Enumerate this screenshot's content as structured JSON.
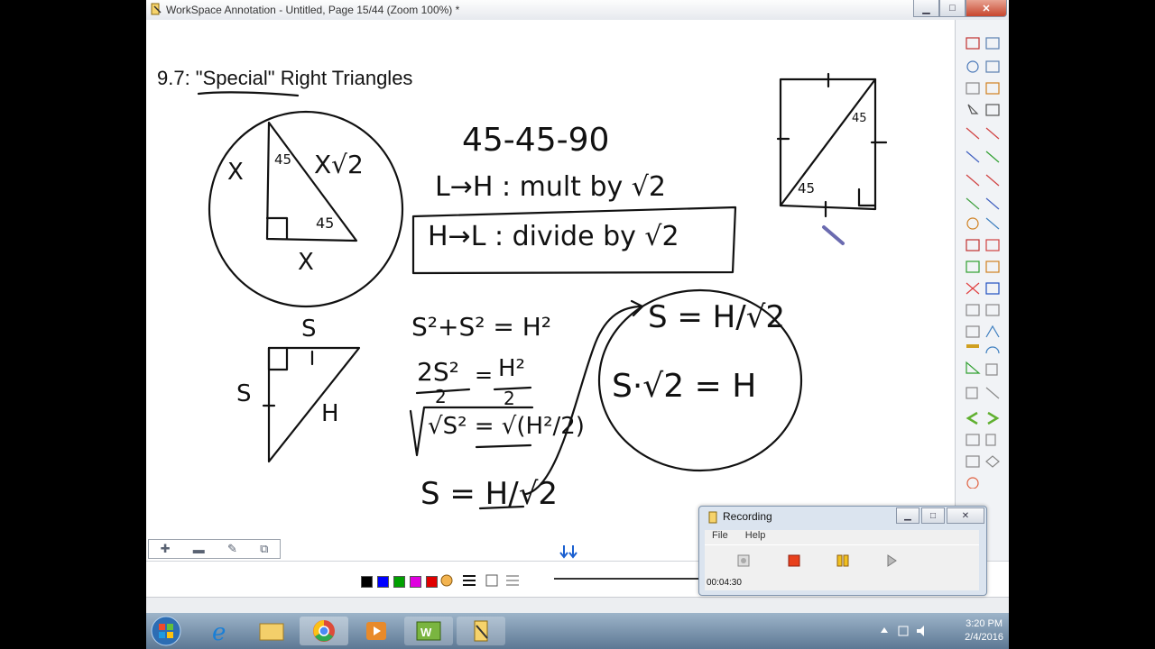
{
  "window": {
    "title": "WorkSpace Annotation - Untitled, Page 15/44  (Zoom 100%) *",
    "minimize": "▁",
    "maximize": "□",
    "close": "✕"
  },
  "heading": "9.7: \"Special\" Right Triangles",
  "handwriting": {
    "label_x_left": "X",
    "label_45_top": "45",
    "label_xroot2": "X√2",
    "label_45_bottom": "45",
    "label_x_bottom": "X",
    "rule_title": "45-45-90",
    "rule_l_to_h": "L→H  : mult by √2",
    "rule_h_to_l": "H→L  : divide by √2",
    "square_45_top": "45",
    "square_45_bottom": "45",
    "s_top": "S",
    "s_left": "S",
    "h_label": "H",
    "eq1": "S²+S² = H²",
    "eq2_num_left": "2S²",
    "eq2_eq": "=",
    "eq2_num_right": "H²",
    "eq2_den_left": "2",
    "eq2_den_right": "2",
    "eq3": "√S² = √(H²/2)",
    "eq4": "S = H/√2",
    "circle_eq1": "S = H/√2",
    "circle_eq2": "S·√2 = H"
  },
  "mini_toolbar": {
    "add": "✚",
    "remove": "▬",
    "edit": "✎",
    "pages": "⧉"
  },
  "swatches": [
    "#000000",
    "#0000ff",
    "#00a000",
    "#e000e0",
    "#e00000"
  ],
  "recording": {
    "title": "Recording",
    "menu_file": "File",
    "menu_help": "Help",
    "elapsed": "00:04:30",
    "min": "▁",
    "max": "□",
    "close": "✕"
  },
  "clock": {
    "time": "3:20 PM",
    "date": "2/4/2016"
  }
}
